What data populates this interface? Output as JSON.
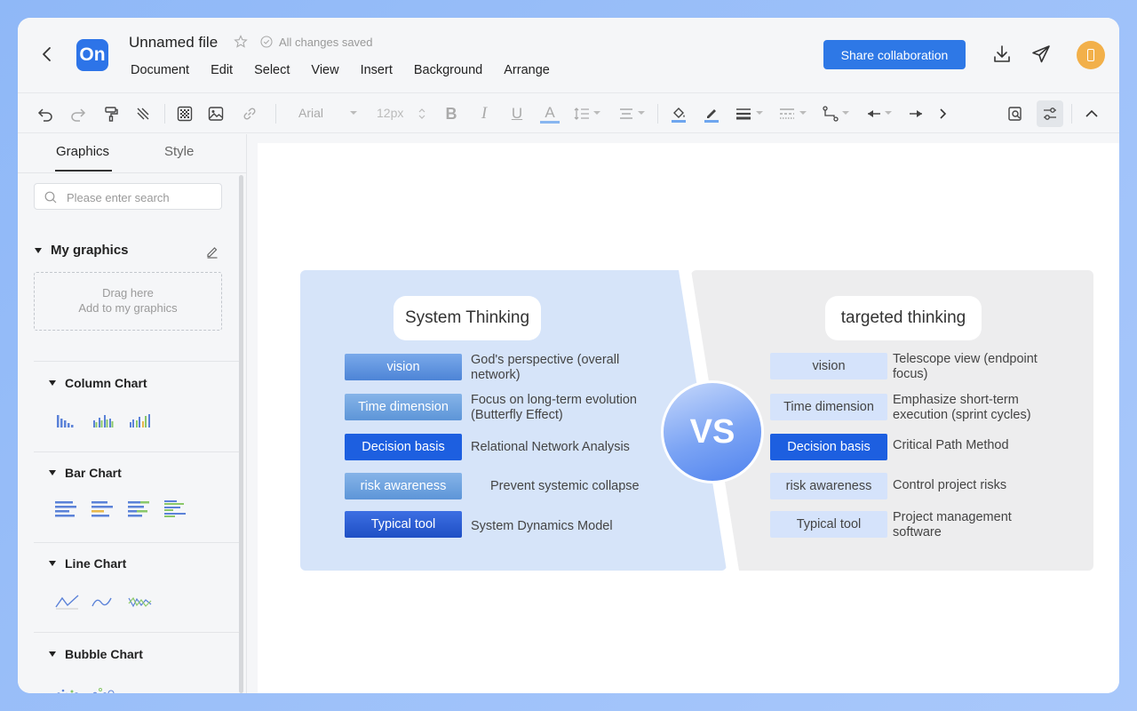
{
  "header": {
    "logo_text": "On",
    "file_title": "Unnamed file",
    "saved_status": "All changes saved",
    "share_label": "Share collaboration",
    "menu": [
      "Document",
      "Edit",
      "Select",
      "View",
      "Insert",
      "Background",
      "Arrange"
    ]
  },
  "toolbar": {
    "font_name": "Arial",
    "font_size": "12px",
    "bold": "B",
    "italic": "I",
    "underline": "U",
    "font_color": "A"
  },
  "sidebar": {
    "tabs": [
      "Graphics",
      "Style"
    ],
    "search_placeholder": "Please enter search",
    "my_graphics": "My graphics",
    "drop_line1": "Drag here",
    "drop_line2": "Add to my graphics",
    "sections": [
      "Column Chart",
      "Bar Chart",
      "Line Chart",
      "Bubble Chart"
    ]
  },
  "diagram": {
    "vs_label": "VS",
    "left": {
      "title": "System Thinking",
      "rows": [
        {
          "label": "vision",
          "desc": "God's perspective (overall network)"
        },
        {
          "label": "Time dimension",
          "desc": "Focus on long-term evolution (Butterfly Effect)"
        },
        {
          "label": "Decision basis",
          "desc": "Relational Network Analysis"
        },
        {
          "label": "risk awareness",
          "desc": "Prevent systemic collapse"
        },
        {
          "label": "Typical tool",
          "desc": "System Dynamics Model"
        }
      ]
    },
    "right": {
      "title": "targeted thinking",
      "rows": [
        {
          "label": "vision",
          "desc": "Telescope view (endpoint focus)"
        },
        {
          "label": "Time dimension",
          "desc": "Emphasize short-term execution (sprint cycles)"
        },
        {
          "label": "Decision basis",
          "desc": "Critical Path Method"
        },
        {
          "label": "risk awareness",
          "desc": "Control project risks"
        },
        {
          "label": "Typical tool",
          "desc": "Project management software"
        }
      ]
    }
  },
  "colors": {
    "accent": "#2e78e6",
    "left_panel": "#d6e4f9",
    "right_panel": "#ededee",
    "strong_label": "#1d5fe0"
  }
}
